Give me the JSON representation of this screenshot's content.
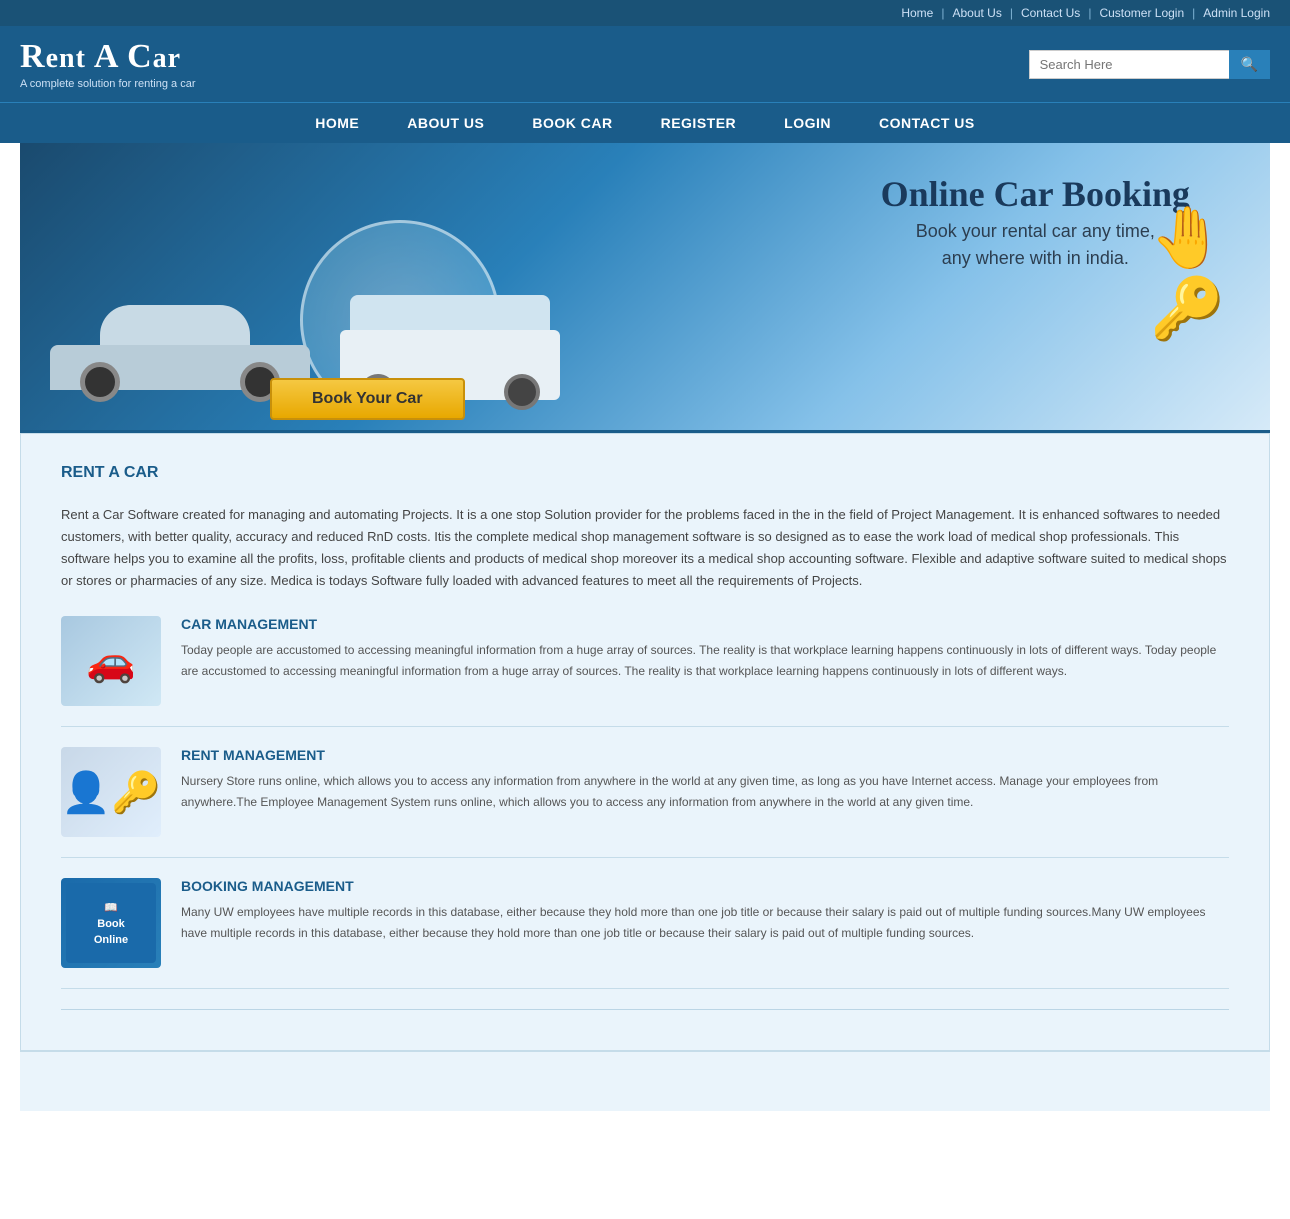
{
  "topbar": {
    "links": [
      "Home",
      "About Us",
      "Contact Us",
      "Customer Login",
      "Admin Login"
    ]
  },
  "header": {
    "title_cap": "R",
    "title_rest": "ent ",
    "title_cap2": "A ",
    "title_cap3": "C",
    "title_rest3": "ar",
    "full_title": "Rent A Car",
    "subtitle": "A complete solution for renting a car",
    "search_placeholder": "Search Here"
  },
  "nav": {
    "items": [
      "HOME",
      "ABOUT US",
      "BOOK CAR",
      "REGISTER",
      "LOGIN",
      "CONTACT US"
    ]
  },
  "hero": {
    "heading": "Online Car Booking",
    "subline1": "Book your rental car any time,",
    "subline2": "any where with in india.",
    "book_button": "Book Your Car"
  },
  "main": {
    "section_title": "RENT A CAR",
    "intro": "Rent a Car Software created for managing and automating Projects. It is a one stop Solution provider for the problems faced in the in the field of Project Management. It is enhanced softwares to needed customers, with better quality, accuracy and reduced RnD costs. Itis the complete medical shop management software is so designed as to ease the work load of medical shop professionals. This software helps you to examine all the profits, loss, profitable clients and products of medical shop moreover its a medical shop accounting software. Flexible and adaptive software suited to medical shops or stores or pharmacies of any size. Medica is todays Software fully loaded with advanced features to meet all the requirements of Projects.",
    "features": [
      {
        "id": "car-management",
        "title": "CAR MANAGEMENT",
        "img_type": "car-mgmt",
        "description": "Today people are accustomed to accessing meaningful information from a huge array of sources. The reality is that workplace learning happens continuously in lots of different ways. Today people are accustomed to accessing meaningful information from a huge array of sources. The reality is that workplace learning happens continuously in lots of different ways."
      },
      {
        "id": "rent-management",
        "title": "RENT MANAGEMENT",
        "img_type": "rent-mgmt",
        "description": "Nursery Store runs online, which allows you to access any information from anywhere in the world at any given time, as long as you have Internet access. Manage your employees from anywhere.The Employee Management System runs online, which allows you to access any information from anywhere in the world at any given time."
      },
      {
        "id": "booking-management",
        "title": "BOOKING MANAGEMENT",
        "img_type": "book-mgmt",
        "description": "Many UW employees have multiple records in this database, either because they hold more than one job title or because their salary is paid out of multiple funding sources.Many UW employees have multiple records in this database, either because they hold more than one job title or because their salary is paid out of multiple funding sources."
      }
    ]
  }
}
